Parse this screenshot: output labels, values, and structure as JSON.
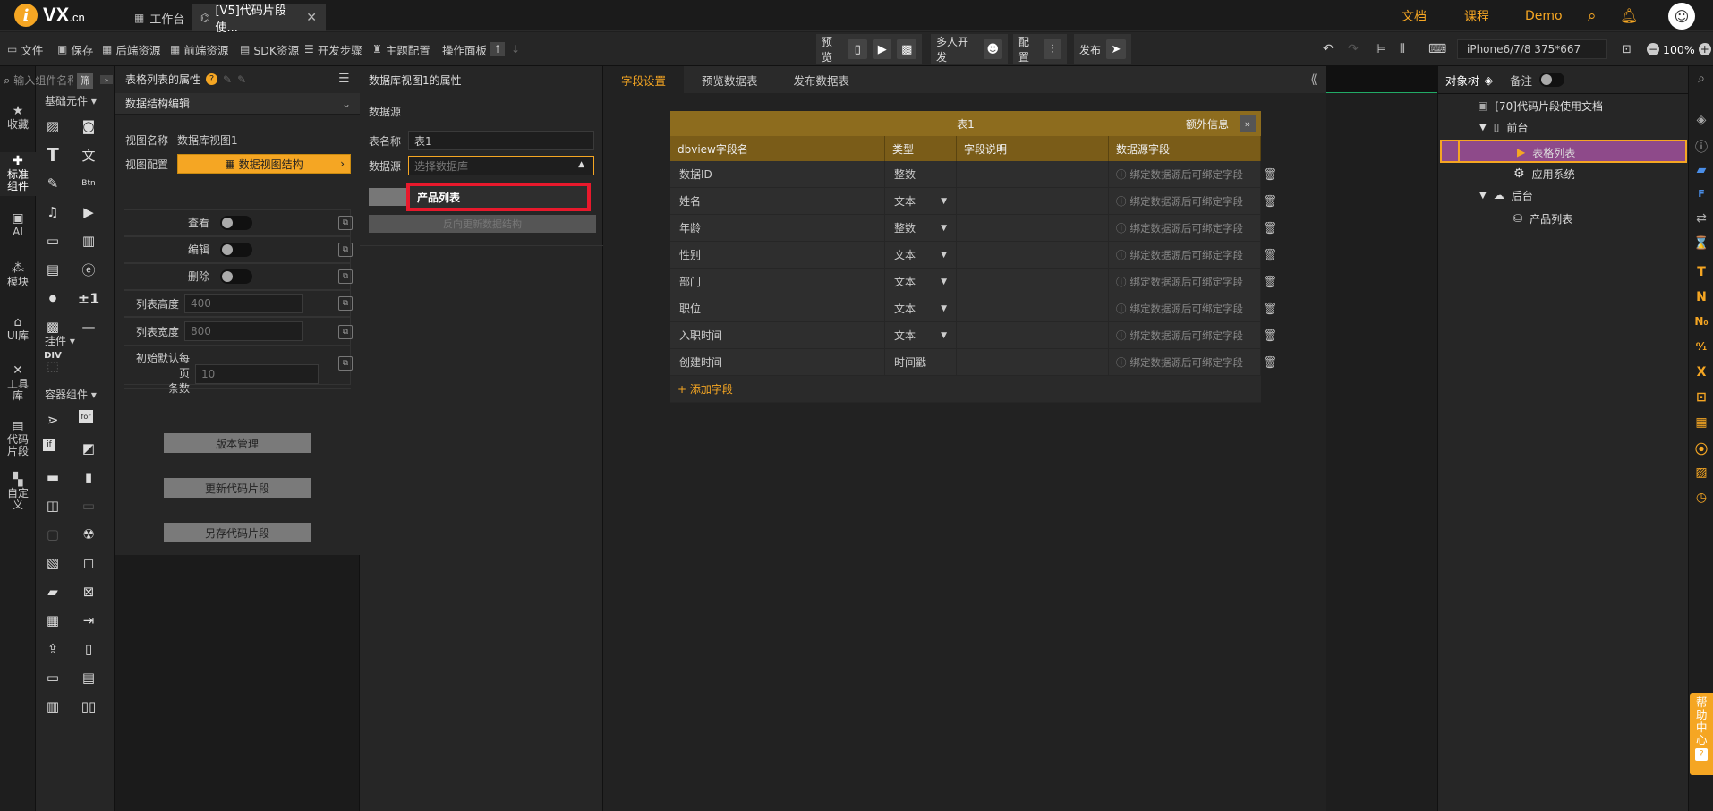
{
  "topbar": {
    "logo_text": "VX",
    "logo_suffix": ".cn",
    "tabs": [
      {
        "label": "工作台"
      },
      {
        "label": "[V5]代码片段使..."
      }
    ],
    "nav": {
      "docs": "文档",
      "courses": "课程",
      "demo": "Demo"
    }
  },
  "toolbar": {
    "file": "文件",
    "save": "保存",
    "backend_res": "后端资源",
    "frontend_res": "前端资源",
    "sdk_res": "SDK资源",
    "dev_steps": "开发步骤",
    "theme": "主题配置",
    "op_panel": "操作面板",
    "preview": "预览",
    "multi_dev": "多人开发",
    "config": "配置",
    "publish": "发布",
    "device": "iPhone6/7/8 375*667",
    "zoom": "100%"
  },
  "leftnav": {
    "items": [
      "收藏",
      "标准组件",
      "AI",
      "模块",
      "UI库",
      "工具库",
      "代码片段",
      "自定义"
    ]
  },
  "components": {
    "basic_title": "基础元件",
    "plugin_title": "挂件",
    "container_title": "容器组件",
    "search_placeholder": "输入组件名称",
    "filter": "筛",
    "div_label": "DIV",
    "plusminus": "±1"
  },
  "props": {
    "title": "表格列表的属性",
    "section": "数据结构编辑",
    "view_name_label": "视图名称",
    "view_name_value": "数据库视图1",
    "view_config_label": "视图配置",
    "view_config_btn": "数据视图结构",
    "toggles": [
      {
        "label": "查看"
      },
      {
        "label": "编辑"
      },
      {
        "label": "删除"
      }
    ],
    "list_height_label": "列表高度",
    "list_height_value": "400",
    "list_width_label": "列表宽度",
    "list_width_value": "800",
    "page_size_label1": "初始默认每页",
    "page_size_label2": "条数",
    "page_size_value": "10",
    "btn_version": "版本管理",
    "btn_update": "更新代码片段",
    "btn_saveas": "另存代码片段"
  },
  "dbview": {
    "title": "数据库视图1的属性",
    "datasource_section": "数据源",
    "table_name_label": "表名称",
    "table_name_value": "表1",
    "datasource_label": "数据源",
    "datasource_placeholder": "选择数据库",
    "dropdown_option": "产品列表",
    "hidden_btn_text": "反向更新数据结构"
  },
  "main": {
    "tabs": [
      "字段设置",
      "预览数据表",
      "发布数据表"
    ],
    "table_title": "表1",
    "extra_info": "额外信息",
    "columns": [
      "dbview字段名",
      "类型",
      "字段说明",
      "数据源字段"
    ],
    "rows": [
      {
        "name": "数据ID",
        "type": "整数",
        "desc": "",
        "source": "绑定数据源后可绑定字段",
        "dropdown": false
      },
      {
        "name": "姓名",
        "type": "文本",
        "desc": "",
        "source": "绑定数据源后可绑定字段",
        "dropdown": true
      },
      {
        "name": "年龄",
        "type": "整数",
        "desc": "",
        "source": "绑定数据源后可绑定字段",
        "dropdown": true
      },
      {
        "name": "性别",
        "type": "文本",
        "desc": "",
        "source": "绑定数据源后可绑定字段",
        "dropdown": true
      },
      {
        "name": "部门",
        "type": "文本",
        "desc": "",
        "source": "绑定数据源后可绑定字段",
        "dropdown": true
      },
      {
        "name": "职位",
        "type": "文本",
        "desc": "",
        "source": "绑定数据源后可绑定字段",
        "dropdown": true
      },
      {
        "name": "入职时间",
        "type": "文本",
        "desc": "",
        "source": "绑定数据源后可绑定字段",
        "dropdown": true
      },
      {
        "name": "创建时间",
        "type": "时间戳",
        "desc": "",
        "source": "绑定数据源后可绑定字段",
        "dropdown": false
      }
    ],
    "add_field": "+ 添加字段"
  },
  "objtree": {
    "tab_tree": "对象树",
    "tab_note": "备注",
    "nodes": [
      {
        "label": "[70]代码片段使用文档"
      },
      {
        "label": "前台"
      },
      {
        "label": "表格列表"
      },
      {
        "label": "应用系统"
      },
      {
        "label": "后台"
      },
      {
        "label": "产品列表"
      }
    ]
  },
  "help": {
    "label": "帮助中心",
    "q": "?"
  },
  "colors": {
    "accent": "#f5a623",
    "highlight_red": "#e8192c",
    "selected_purple": "#8e4a8a"
  }
}
